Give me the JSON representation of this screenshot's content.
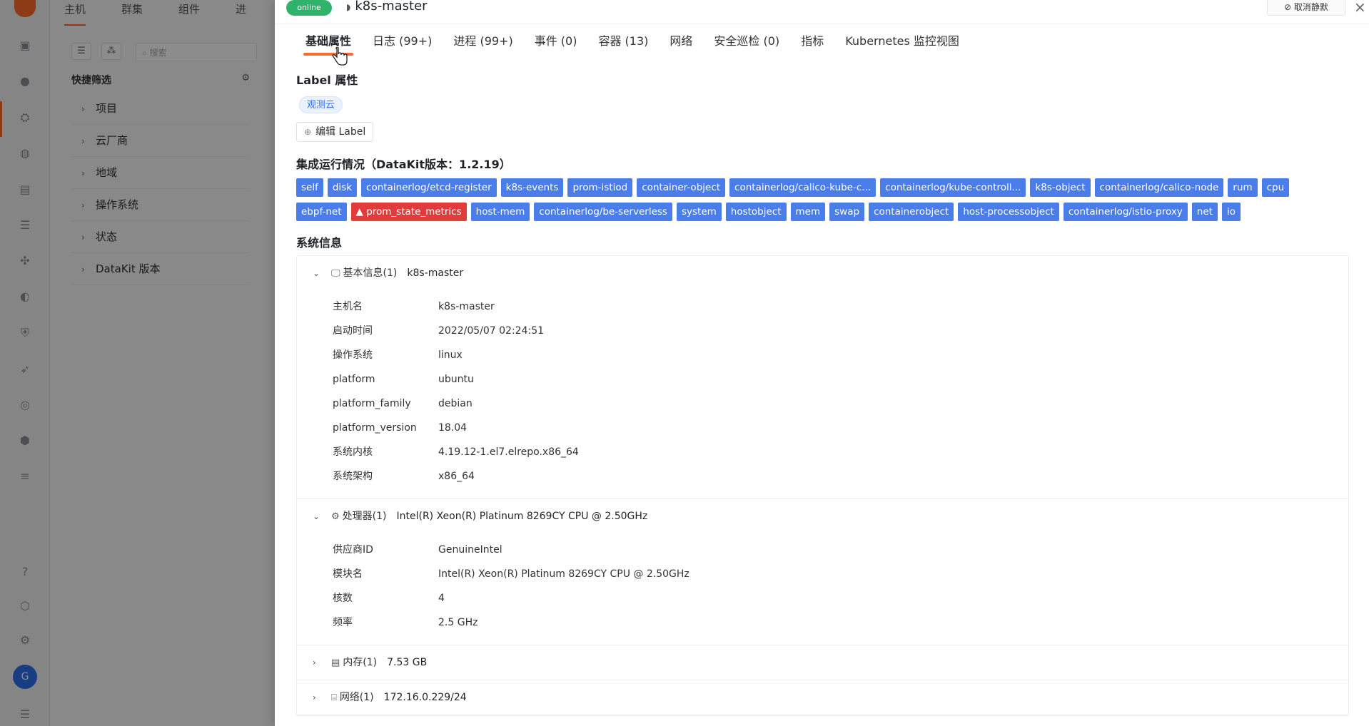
{
  "background": {
    "tabs": [
      "主机",
      "群集",
      "组件",
      "进"
    ],
    "search_placeholder": "搜索",
    "filter_title": "快捷筛选",
    "filters": [
      "项目",
      "云厂商",
      "地域",
      "操作系统",
      "状态",
      "DataKit 版本"
    ],
    "avatar_letter": "G"
  },
  "drawer": {
    "status": "online",
    "title": "k8s-master",
    "unmute_label": "取消静默",
    "close": "×",
    "tabs": [
      {
        "label": "基础属性"
      },
      {
        "label": "日志 (99+)"
      },
      {
        "label": "进程 (99+)"
      },
      {
        "label": "事件 (0)"
      },
      {
        "label": "容器 (13)"
      },
      {
        "label": "网络"
      },
      {
        "label": "安全巡检 (0)"
      },
      {
        "label": "指标"
      },
      {
        "label": "Kubernetes 监控视图"
      }
    ],
    "label_section": {
      "title": "Label 属性",
      "tags": [
        "观测云"
      ],
      "edit_button": "编辑 Label"
    },
    "integration_section": {
      "title": "集成运行情况（DataKit版本：1.2.19）",
      "row1": [
        "self",
        "disk",
        "containerlog/etcd-register",
        "k8s-events",
        "prom-istiod",
        "container-object",
        "containerlog/calico-kube-c...",
        "containerlog/kube-controll...",
        "k8s-object",
        "containerlog/calico-node",
        "rum",
        "cpu"
      ],
      "row2": [
        "ebpf-net",
        "prom_state_metrics",
        "host-mem",
        "containerlog/be-serverless",
        "system",
        "hostobject",
        "mem",
        "swap",
        "containerobject",
        "host-processobject",
        "containerlog/istio-proxy",
        "net",
        "io"
      ],
      "error_tag": "prom_state_metrics"
    },
    "system_section": {
      "title": "系统信息",
      "groups": [
        {
          "name": "基本信息(1)",
          "value": "k8s-master",
          "icon": "monitor-icon",
          "expanded": true,
          "rows": [
            {
              "k": "主机名",
              "v": "k8s-master"
            },
            {
              "k": "启动时间",
              "v": "2022/05/07 02:24:51"
            },
            {
              "k": "操作系统",
              "v": "linux"
            },
            {
              "k": "platform",
              "v": "ubuntu"
            },
            {
              "k": "platform_family",
              "v": "debian"
            },
            {
              "k": "platform_version",
              "v": "18.04"
            },
            {
              "k": "系统内核",
              "v": "4.19.12-1.el7.elrepo.x86_64"
            },
            {
              "k": "系统架构",
              "v": "x86_64"
            }
          ]
        },
        {
          "name": "处理器(1)",
          "value": "Intel(R) Xeon(R) Platinum 8269CY CPU @ 2.50GHz",
          "icon": "cpu-icon",
          "expanded": true,
          "rows": [
            {
              "k": "供应商ID",
              "v": "GenuineIntel"
            },
            {
              "k": "模块名",
              "v": "Intel(R) Xeon(R) Platinum 8269CY CPU @ 2.50GHz"
            },
            {
              "k": "核数",
              "v": "4"
            },
            {
              "k": "频率",
              "v": "2.5 GHz"
            }
          ]
        },
        {
          "name": "内存(1)",
          "value": "7.53 GB",
          "icon": "memory-icon",
          "expanded": false,
          "rows": []
        },
        {
          "name": "网络(1)",
          "value": "172.16.0.229/24",
          "icon": "network-icon",
          "expanded": false,
          "rows": []
        }
      ]
    }
  },
  "colors": {
    "accent": "#ff6a2a",
    "tag_blue": "#4a7dea",
    "tag_error": "#e03c3c",
    "status_green": "#2fb36a"
  }
}
